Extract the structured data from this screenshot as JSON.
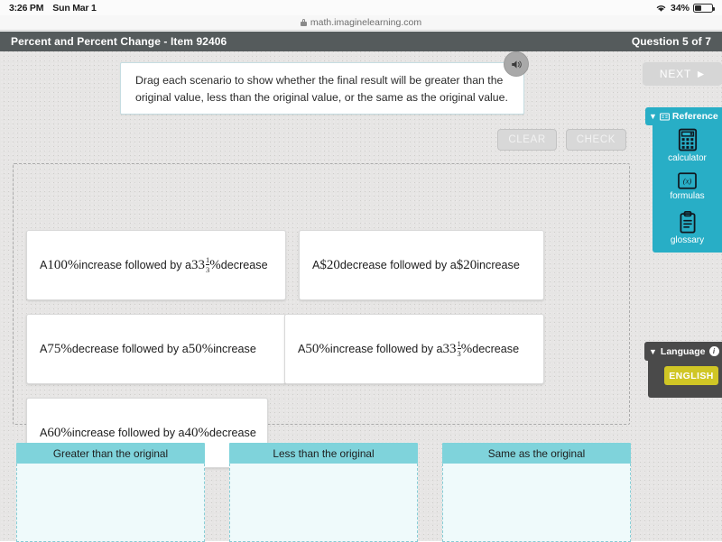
{
  "status_bar": {
    "clock": "3:26 PM",
    "date": "Sun Mar 1",
    "battery_percent": "34%",
    "wifi_icon": "wifi-icon",
    "battery_icon": "battery-icon"
  },
  "browser": {
    "url": "math.imaginelearning.com",
    "lock_icon": "lock-icon"
  },
  "title_bar": {
    "lesson_title": "Percent and Percent Change - Item 92406",
    "question_count": "Question 5 of 7"
  },
  "prompt": {
    "text": "Drag each scenario to show whether the final result will be greater than the original value, less than the original value, or the same as the original value.",
    "audio_icon": "speaker-icon"
  },
  "actions": {
    "clear_label": "CLEAR",
    "check_label": "CHECK"
  },
  "scenarios": [
    {
      "id": "scenario-100-increase-33-decrease",
      "prefix": "A ",
      "value1": "100%",
      "mid": " increase followed by a ",
      "value2": "33",
      "fraction_numerator": "1",
      "fraction_denominator": "3",
      "value2_suffix": "%",
      "suffix": " decrease"
    },
    {
      "id": "scenario-20-decrease-20-increase",
      "prefix": "A ",
      "value1": "$20",
      "mid": " decrease followed by a ",
      "value2": "$20",
      "fraction_numerator": "",
      "fraction_denominator": "",
      "value2_suffix": "",
      "suffix": " increase"
    },
    {
      "id": "scenario-75-decrease-50-increase",
      "prefix": "A ",
      "value1": "75%",
      "mid": " decrease followed by a ",
      "value2": "50",
      "fraction_numerator": "",
      "fraction_denominator": "",
      "value2_suffix": "%",
      "suffix": " increase"
    },
    {
      "id": "scenario-50-increase-33-decrease",
      "prefix": "A ",
      "value1": "50%",
      "mid": " increase followed by a ",
      "value2": "33",
      "fraction_numerator": "1",
      "fraction_denominator": "3",
      "value2_suffix": "%",
      "suffix": " decrease"
    },
    {
      "id": "scenario-60-increase-40-decrease",
      "prefix": "A ",
      "value1": "60%",
      "mid": " increase followed by a ",
      "value2": "40",
      "fraction_numerator": "",
      "fraction_denominator": "",
      "value2_suffix": "%",
      "suffix": " decrease"
    }
  ],
  "drop_zones": [
    {
      "label": "Greater than the original",
      "items": []
    },
    {
      "label": "Less than the original",
      "items": []
    },
    {
      "label": "Same as the original",
      "items": []
    }
  ],
  "right_rail": {
    "next_label": "NEXT",
    "next_arrow": "play-triangle-icon",
    "reference": {
      "title": "Reference",
      "caret": "▼",
      "tab_icon": "book-icon",
      "items": [
        {
          "label": "calculator",
          "icon": "calculator-icon"
        },
        {
          "label": "formulas",
          "icon": "formulas-icon"
        },
        {
          "label": "glossary",
          "icon": "clipboard-icon"
        }
      ]
    },
    "language": {
      "title": "Language",
      "caret": "▼",
      "info_icon": "info-icon",
      "info_glyph": "i",
      "selected": "ENGLISH"
    }
  },
  "colors": {
    "title_bar": "#555b5c",
    "reference_teal": "#28aec6",
    "drop_header_teal": "#7fd3db",
    "drop_body_teal": "#effafb",
    "language_grey": "#4a4a4a",
    "english_yellow": "#d0c625",
    "canvas_grey": "#e6e5e4"
  }
}
